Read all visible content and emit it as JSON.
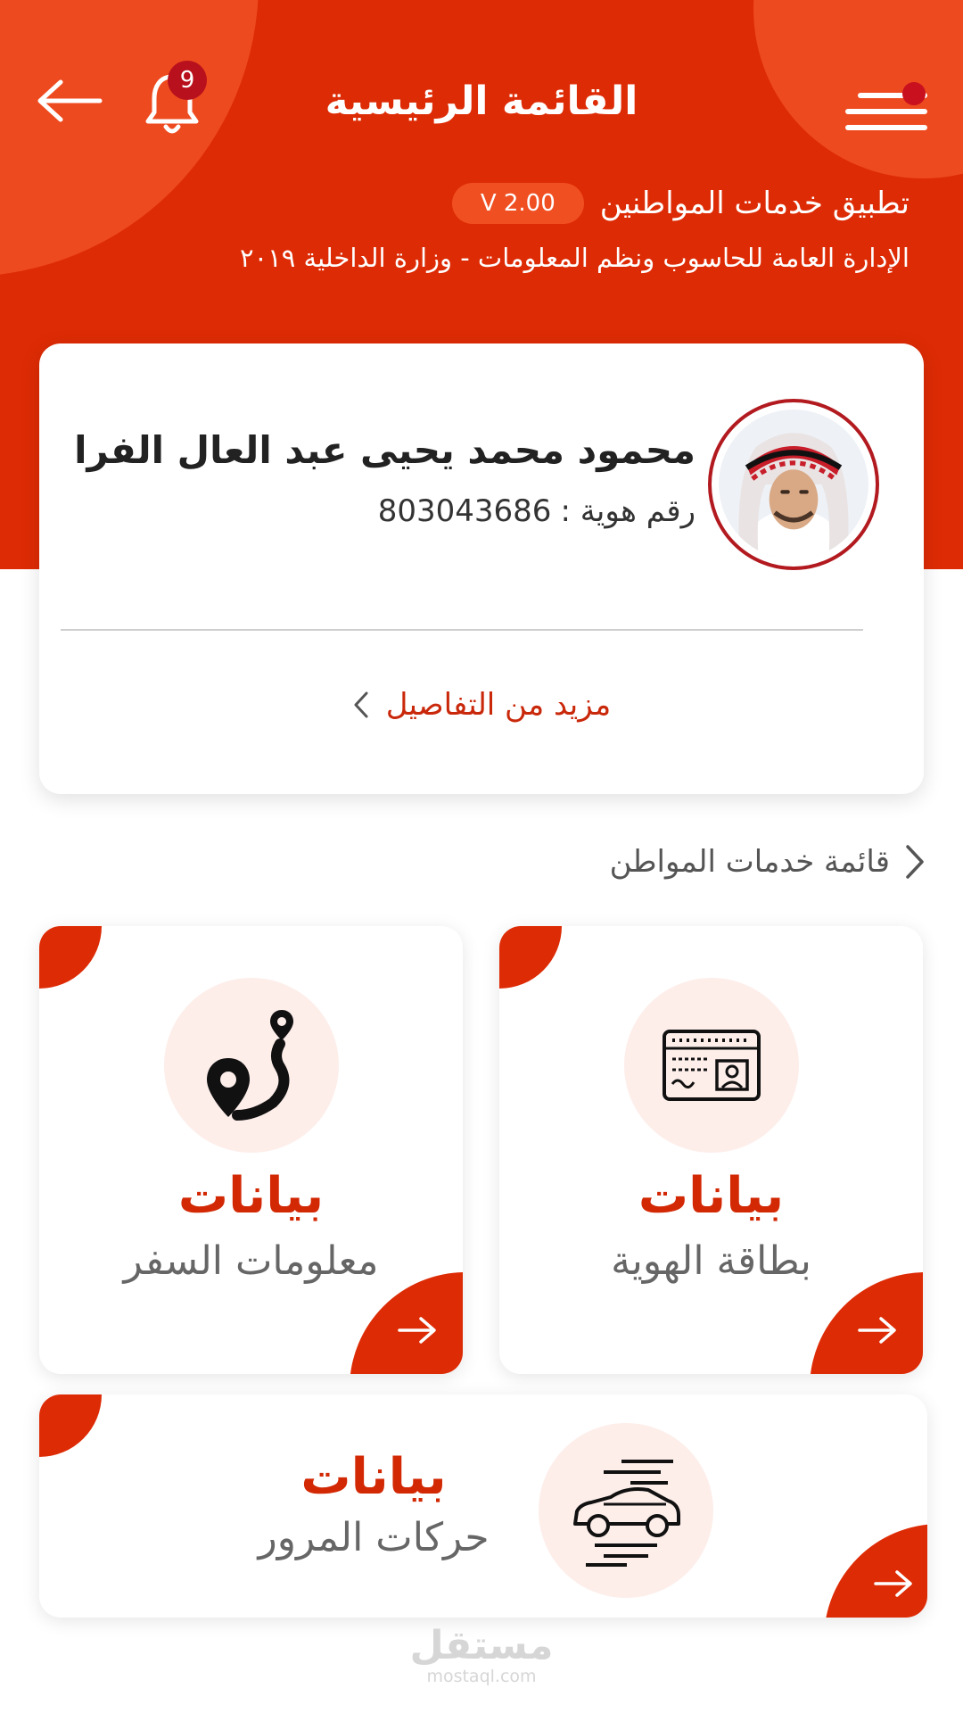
{
  "header": {
    "title": "القائمة الرئيسية",
    "notification_count": "9",
    "app_name": "تطبيق خدمات المواطنين",
    "version": "V 2.00",
    "department": "الإدارة العامة للحاسوب ونظم المعلومات - وزارة الداخلية ٢٠١٩"
  },
  "profile": {
    "name": "محمود محمد يحيى عبد العال الفرا",
    "id_label": "رقم هوية :",
    "id_number": "803043686",
    "more_details": "مزيد من التفاصيل"
  },
  "services": {
    "section_title": "قائمة خدمات المواطن",
    "items": [
      {
        "title": "بيانات",
        "subtitle": "بطاقة الهوية",
        "icon": "id-card-icon"
      },
      {
        "title": "بيانات",
        "subtitle": "معلومات السفر",
        "icon": "travel-route-icon"
      },
      {
        "title": "بيانات",
        "subtitle": "حركات المرور",
        "icon": "car-icon"
      }
    ]
  },
  "watermark": {
    "arabic": "مستقل",
    "latin": "mostaql.com"
  },
  "colors": {
    "primary": "#dd2b05",
    "accent": "#ee4a1f",
    "badge": "#b8101c",
    "icon_bg": "#fdeeea"
  }
}
